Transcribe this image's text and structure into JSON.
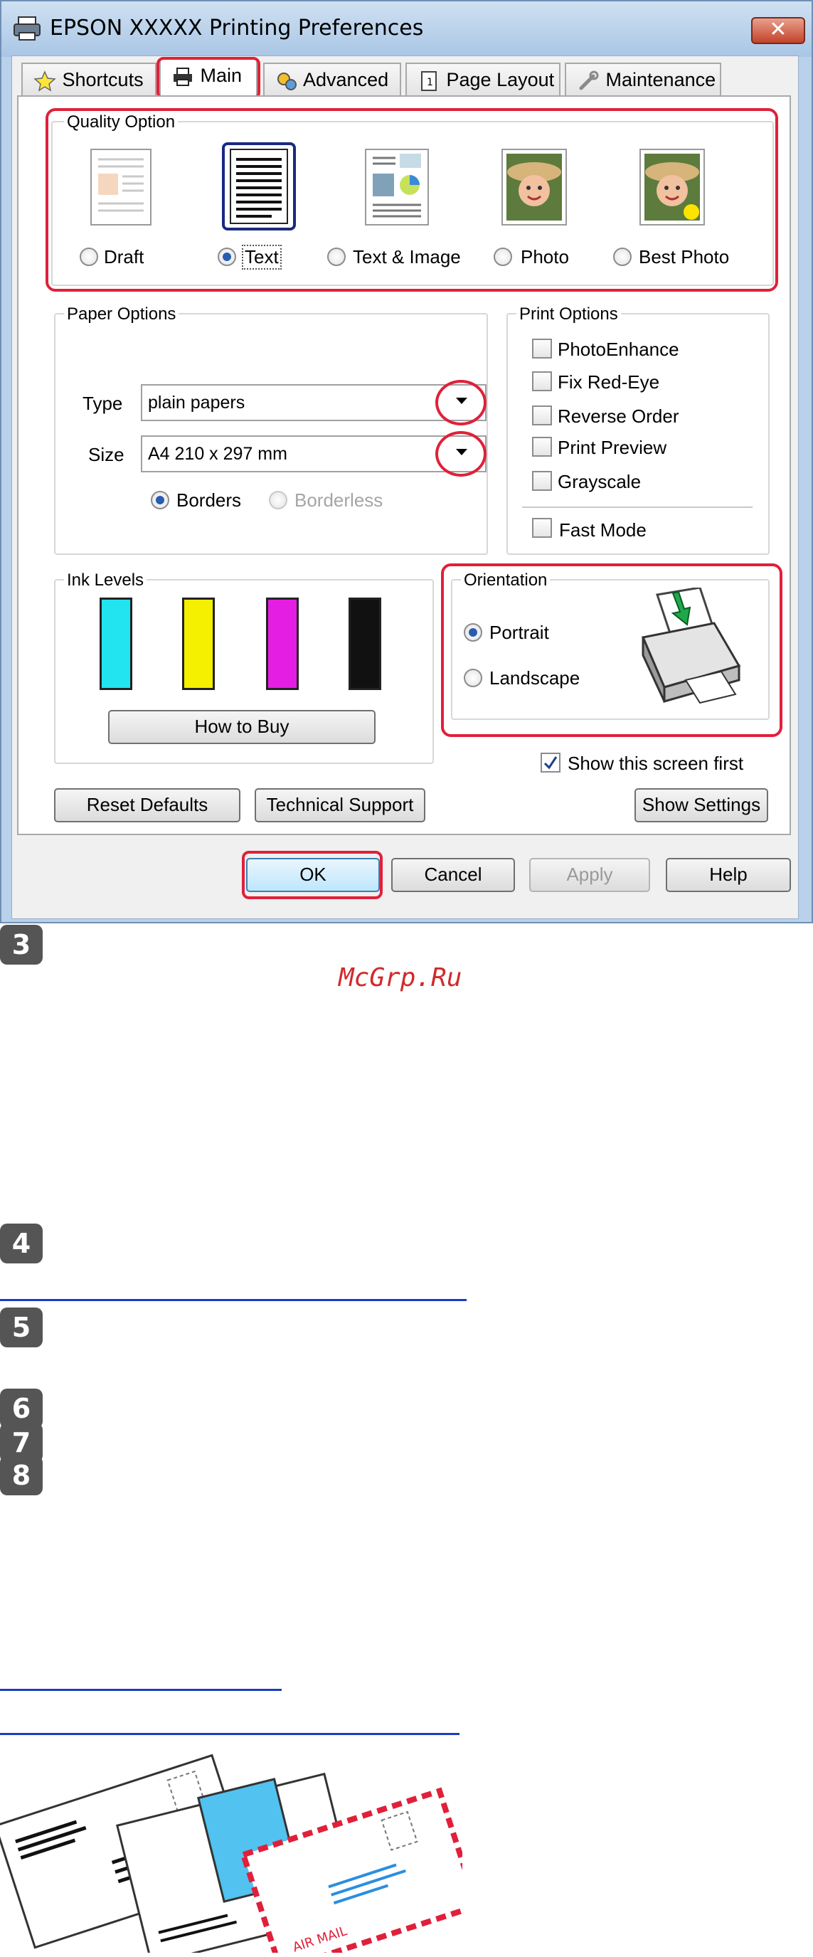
{
  "window": {
    "title": "EPSON XXXXX  Printing Preferences",
    "close_label": "✕"
  },
  "tabs": [
    {
      "label": "Shortcuts",
      "icon": "star-icon"
    },
    {
      "label": "Main",
      "icon": "printer-icon",
      "selected": true
    },
    {
      "label": "Advanced",
      "icon": "gears-icon"
    },
    {
      "label": "Page Layout",
      "icon": "page-icon"
    },
    {
      "label": "Maintenance",
      "icon": "wrench-icon"
    }
  ],
  "quality": {
    "title": "Quality Option",
    "options": [
      {
        "label": "Draft",
        "selected": false
      },
      {
        "label": "Text",
        "selected": true
      },
      {
        "label": "Text & Image",
        "selected": false
      },
      {
        "label": "Photo",
        "selected": false
      },
      {
        "label": "Best Photo",
        "selected": false
      }
    ]
  },
  "paper": {
    "title": "Paper Options",
    "type_label": "Type",
    "type_value": "plain papers",
    "size_label": "Size",
    "size_value": "A4 210 x 297 mm",
    "borders_label": "Borders",
    "borderless_label": "Borderless"
  },
  "print_options": {
    "title": "Print Options",
    "items": [
      "PhotoEnhance",
      "Fix Red-Eye",
      "Reverse Order",
      "Print Preview",
      "Grayscale"
    ],
    "fast_mode": "Fast Mode"
  },
  "ink": {
    "title": "Ink Levels",
    "colors": [
      "#22e4f0",
      "#f4f000",
      "#e51ee3",
      "#111111"
    ],
    "buy_label": "How to Buy"
  },
  "orientation": {
    "title": "Orientation",
    "portrait": "Portrait",
    "landscape": "Landscape"
  },
  "show_first": "Show this screen first",
  "buttons": {
    "reset": "Reset Defaults",
    "support": "Technical Support",
    "show_settings": "Show Settings",
    "ok": "OK",
    "cancel": "Cancel",
    "apply": "Apply",
    "help": "Help"
  },
  "steps": [
    "3",
    "4",
    "5",
    "6",
    "7",
    "8"
  ],
  "watermark": "McGrp.Ru",
  "accent_red": "#e0203a"
}
